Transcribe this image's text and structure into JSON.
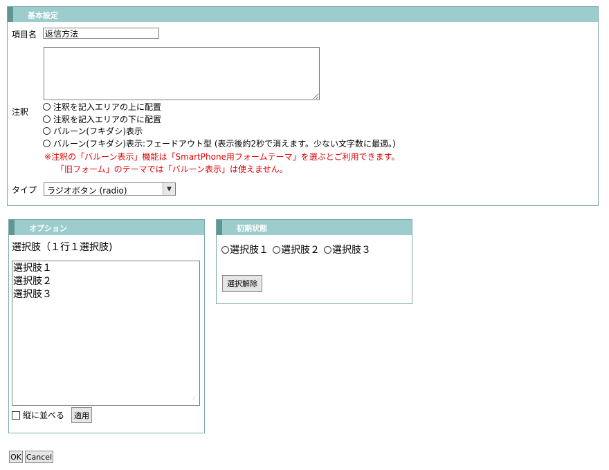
{
  "basic": {
    "header": "基本設定",
    "item_name_label": "項目名",
    "item_name_value": "返信方法",
    "note_label": "注釈",
    "note_position_options": [
      "注釈を記入エリアの上に配置",
      "注釈を記入エリアの下に配置",
      "バルーン(フキダシ)表示",
      "バルーン(フキダシ)表示:フェードアウト型 (表示後約2秒で消えます。少ない文字数に最適。)"
    ],
    "warning_line1": "※注釈の「バルーン表示」機能は「SmartPhone用フォームテーマ」を選ぶとご利用できます。",
    "warning_line2": "「旧フォーム」のテーマでは「バルーン表示」は使えません。",
    "type_label": "タイプ",
    "type_value": "ラジオボタン (radio)"
  },
  "options": {
    "header": "オプション",
    "choices_label": "選択肢（１行１選択肢)",
    "choices": [
      "選択肢１",
      "選択肢２",
      "選択肢３"
    ],
    "vertical_label": "縦に並べる",
    "apply_label": "適用"
  },
  "initial": {
    "header": "初期状態",
    "radios": [
      "選択肢１",
      "選択肢２",
      "選択肢３"
    ],
    "clear_label": "選択解除"
  },
  "footer": {
    "ok_label": "OK",
    "cancel_label": "Cancel"
  },
  "colors": {
    "header_bg": "#9ccccc",
    "header_accent": "#5f9595",
    "warning": "#e00000"
  }
}
